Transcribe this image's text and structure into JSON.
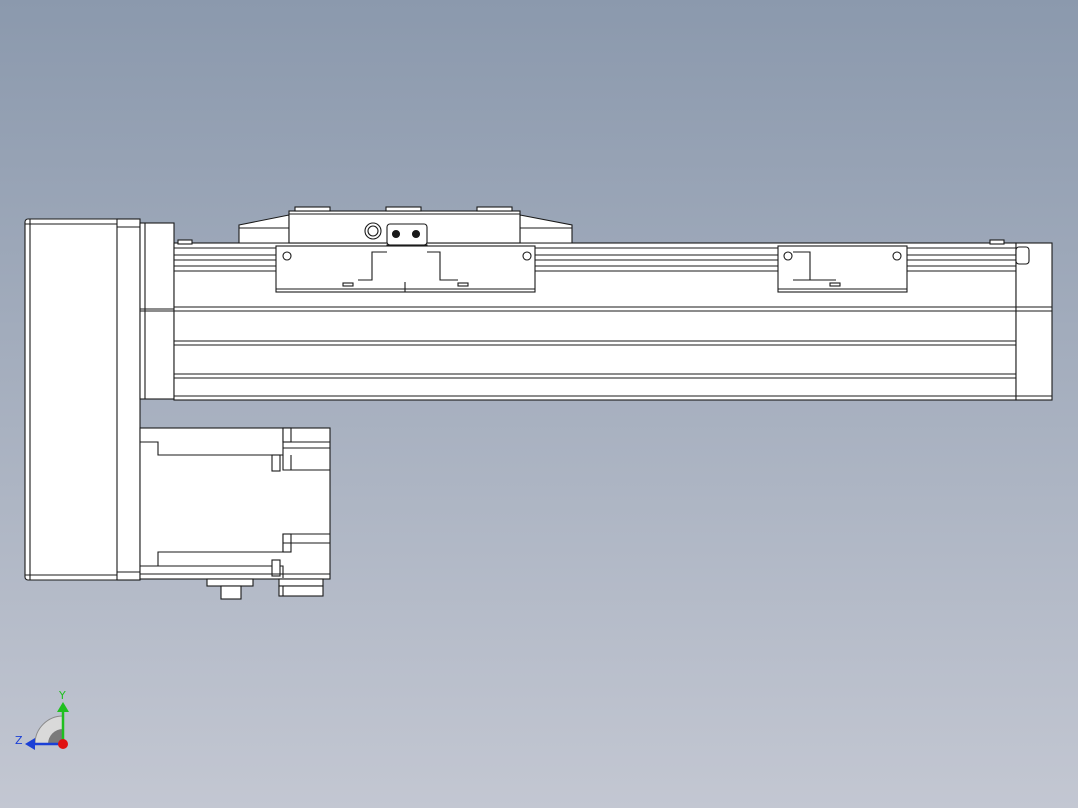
{
  "viewport": {
    "background_top": "#8b99ad",
    "background_bottom": "#c3c7d2",
    "part_fill": "#ffffff",
    "edge_color": "#1a1a1a"
  },
  "triad": {
    "y_label": "Y",
    "z_label": "Z",
    "y_color": "#1fbf1f",
    "z_color": "#1a3fd6",
    "x_dot_color": "#e01010"
  }
}
